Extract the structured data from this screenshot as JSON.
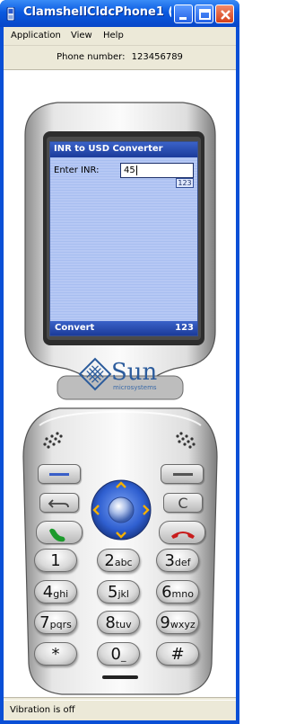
{
  "window": {
    "title": "ClamshellCldcPhone1 (..."
  },
  "menu": {
    "items": [
      "Application",
      "View",
      "Help"
    ]
  },
  "phone_number": {
    "label": "Phone number:",
    "value": "123456789"
  },
  "screen": {
    "title": "INR to USD Converter",
    "input_label": "Enter INR:",
    "input_value": "45",
    "input_mode": "123",
    "softkey_left": "Convert",
    "softkey_right": "123"
  },
  "brand": {
    "name": "Sun",
    "tagline": "microsystems"
  },
  "keypad": {
    "keys": [
      {
        "digit": "1",
        "letters": ""
      },
      {
        "digit": "2",
        "letters": "abc"
      },
      {
        "digit": "3",
        "letters": "def"
      },
      {
        "digit": "4",
        "letters": "ghi"
      },
      {
        "digit": "5",
        "letters": "jkl"
      },
      {
        "digit": "6",
        "letters": "mno"
      },
      {
        "digit": "7",
        "letters": "pqrs"
      },
      {
        "digit": "8",
        "letters": "tuv"
      },
      {
        "digit": "9",
        "letters": "wxyz"
      },
      {
        "digit": "*",
        "letters": ""
      },
      {
        "digit": "0",
        "letters": "_"
      },
      {
        "digit": "#",
        "letters": ""
      }
    ],
    "clear_label": "C"
  },
  "icons": {
    "title": "java-phone-icon",
    "minimize": "minimize-icon",
    "maximize": "maximize-icon",
    "close": "close-icon",
    "back": "back-arrow-icon",
    "send": "green-phone-icon",
    "end": "red-phone-icon",
    "nav": "navigation-pad-icon",
    "sun_logo": "sun-logo-icon",
    "speaker": "speaker-grille-icon"
  },
  "colors": {
    "titlebar": "#0a5ae0",
    "screen_bar": "#1b3b9a",
    "screen_bg": "#b6c8f4",
    "nav_pad": "#2f5fd0",
    "send_key": "#1c9a2c",
    "end_key": "#c81c1c",
    "sun_logo": "#2c5c9c"
  },
  "status": {
    "text": "Vibration is off"
  }
}
